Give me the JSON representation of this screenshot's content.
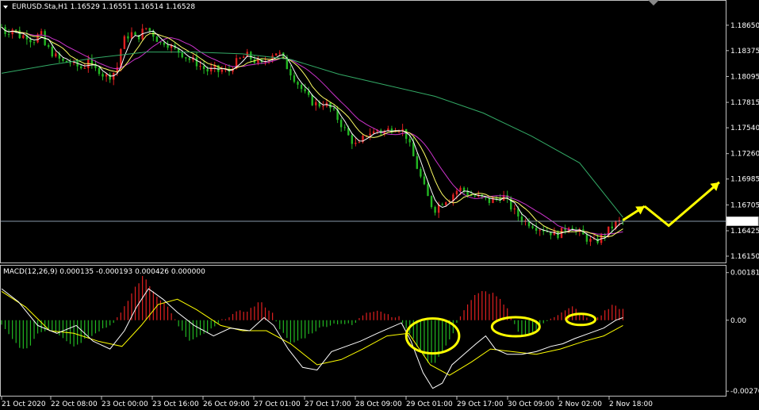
{
  "header": {
    "symbol_line": "EURUSD.Sta,H1  1.16529 1.16551 1.16514 1.16528",
    "macd_line": "MACD(12,26,9) 0.000135 -0.000193 0.000426 0.000000"
  },
  "colors": {
    "background": "#000000",
    "bull": "#e02020",
    "bear": "#22b822",
    "ma_fast": "#ffffff",
    "ma_mid": "#ffff66",
    "ma_slow": "#cc33cc",
    "ma_long": "#33aa66",
    "macd_line": "#ffffff",
    "signal_line": "#ffff00",
    "annotation": "#ffff00",
    "bid_line": "#8899aa",
    "frame": "#c0c0c0"
  },
  "chart_data": [
    {
      "type": "candlestick",
      "panel": "price",
      "title": "EURUSD.Sta,H1",
      "ohlc_last": {
        "open": 1.16529,
        "high": 1.16551,
        "low": 1.16514,
        "close": 1.16528
      },
      "y_ticks": [
        "1.18650",
        "1.18375",
        "1.18095",
        "1.17815",
        "1.17540",
        "1.17260",
        "1.16985",
        "1.16705",
        "1.16425",
        "1.16150"
      ],
      "y_tick_values": [
        1.1865,
        1.18375,
        1.18095,
        1.17815,
        1.1754,
        1.1726,
        1.16985,
        1.16705,
        1.16425,
        1.1615
      ],
      "ylim": [
        1.1609,
        1.1882
      ],
      "current_price_label": "1.16528",
      "current_price": 1.16528,
      "x_ticks": [
        "21 Oct 2020",
        "22 Oct 08:00",
        "23 Oct 00:00",
        "23 Oct 16:00",
        "26 Oct 09:00",
        "27 Oct 01:00",
        "27 Oct 17:00",
        "28 Oct 09:00",
        "29 Oct 01:00",
        "29 Oct 17:00",
        "30 Oct 09:00",
        "2 Nov 02:00",
        "2 Nov 18:00"
      ],
      "close_path": [
        [
          0,
          1.1863
        ],
        [
          4,
          1.1856
        ],
        [
          8,
          1.1862
        ],
        [
          12,
          1.1858
        ],
        [
          16,
          1.1852
        ],
        [
          20,
          1.1855
        ],
        [
          24,
          1.185
        ],
        [
          28,
          1.1849
        ],
        [
          32,
          1.1858
        ],
        [
          36,
          1.1843
        ],
        [
          40,
          1.1838
        ],
        [
          44,
          1.1832
        ],
        [
          48,
          1.1828
        ],
        [
          52,
          1.1824
        ],
        [
          56,
          1.1826
        ],
        [
          60,
          1.1822
        ],
        [
          64,
          1.182
        ],
        [
          68,
          1.1818
        ],
        [
          72,
          1.183
        ],
        [
          76,
          1.1815
        ],
        [
          80,
          1.1818
        ],
        [
          84,
          1.1812
        ],
        [
          88,
          1.1809
        ],
        [
          92,
          1.1812
        ],
        [
          96,
          1.182
        ],
        [
          100,
          1.1846
        ],
        [
          104,
          1.1853
        ],
        [
          108,
          1.1856
        ],
        [
          112,
          1.185
        ],
        [
          116,
          1.1857
        ],
        [
          120,
          1.1862
        ],
        [
          124,
          1.1858
        ],
        [
          128,
          1.1852
        ],
        [
          132,
          1.1845
        ],
        [
          136,
          1.1848
        ],
        [
          140,
          1.1842
        ],
        [
          144,
          1.1838
        ],
        [
          148,
          1.1836
        ],
        [
          152,
          1.1832
        ],
        [
          156,
          1.1828
        ],
        [
          160,
          1.1826
        ],
        [
          164,
          1.1822
        ],
        [
          168,
          1.1818
        ],
        [
          172,
          1.1815
        ],
        [
          176,
          1.1818
        ],
        [
          180,
          1.1815
        ],
        [
          184,
          1.1817
        ],
        [
          188,
          1.1813
        ],
        [
          192,
          1.1822
        ],
        [
          196,
          1.1826
        ],
        [
          200,
          1.183
        ],
        [
          204,
          1.1832
        ],
        [
          208,
          1.1828
        ],
        [
          212,
          1.1825
        ],
        [
          216,
          1.1822
        ],
        [
          220,
          1.1828
        ],
        [
          224,
          1.1834
        ],
        [
          228,
          1.1836
        ],
        [
          232,
          1.1832
        ],
        [
          236,
          1.1822
        ],
        [
          240,
          1.1814
        ],
        [
          244,
          1.1806
        ],
        [
          248,
          1.1798
        ],
        [
          252,
          1.179
        ],
        [
          256,
          1.1784
        ],
        [
          260,
          1.178
        ],
        [
          264,
          1.1779
        ],
        [
          268,
          1.1781
        ],
        [
          272,
          1.1776
        ],
        [
          276,
          1.177
        ],
        [
          280,
          1.1762
        ],
        [
          284,
          1.1754
        ],
        [
          288,
          1.1745
        ],
        [
          292,
          1.1738
        ],
        [
          296,
          1.1733
        ],
        [
          300,
          1.1742
        ],
        [
          304,
          1.175
        ],
        [
          308,
          1.1748
        ],
        [
          312,
          1.1752
        ],
        [
          316,
          1.1749
        ],
        [
          320,
          1.1751
        ],
        [
          324,
          1.1754
        ],
        [
          328,
          1.1755
        ],
        [
          332,
          1.1753
        ],
        [
          336,
          1.1745
        ],
        [
          340,
          1.173
        ],
        [
          344,
          1.1715
        ],
        [
          348,
          1.17
        ],
        [
          352,
          1.1685
        ],
        [
          356,
          1.1672
        ],
        [
          360,
          1.1666
        ],
        [
          364,
          1.1672
        ],
        [
          368,
          1.1676
        ],
        [
          372,
          1.1678
        ],
        [
          376,
          1.1684
        ],
        [
          380,
          1.1688
        ],
        [
          384,
          1.1686
        ],
        [
          388,
          1.1682
        ],
        [
          392,
          1.168
        ],
        [
          396,
          1.1679
        ],
        [
          400,
          1.1677
        ],
        [
          404,
          1.1674
        ],
        [
          408,
          1.1676
        ],
        [
          412,
          1.1678
        ],
        [
          416,
          1.1681
        ],
        [
          420,
          1.1674
        ],
        [
          424,
          1.1666
        ],
        [
          428,
          1.166
        ],
        [
          432,
          1.1655
        ],
        [
          436,
          1.1652
        ],
        [
          440,
          1.165
        ],
        [
          444,
          1.1647
        ],
        [
          448,
          1.1645
        ],
        [
          452,
          1.1643
        ],
        [
          456,
          1.1641
        ],
        [
          460,
          1.1638
        ],
        [
          464,
          1.164
        ],
        [
          468,
          1.1645
        ],
        [
          472,
          1.165
        ],
        [
          476,
          1.1642
        ],
        [
          480,
          1.164
        ],
        [
          484,
          1.1636
        ],
        [
          488,
          1.1632
        ],
        [
          492,
          1.163
        ],
        [
          496,
          1.1633
        ],
        [
          500,
          1.1638
        ],
        [
          504,
          1.1643
        ],
        [
          508,
          1.1648
        ],
        [
          512,
          1.1652
        ],
        [
          516,
          1.1653
        ]
      ],
      "ma_long_path": [
        [
          0,
          1.1813
        ],
        [
          40,
          1.1822
        ],
        [
          80,
          1.183
        ],
        [
          120,
          1.1836
        ],
        [
          160,
          1.1836
        ],
        [
          200,
          1.1834
        ],
        [
          240,
          1.1828
        ],
        [
          280,
          1.1812
        ],
        [
          320,
          1.18
        ],
        [
          360,
          1.1788
        ],
        [
          400,
          1.177
        ],
        [
          440,
          1.1745
        ],
        [
          480,
          1.1716
        ],
        [
          516,
          1.1657
        ]
      ],
      "annotation_arrow_prices": [
        1.1654,
        1.1669,
        1.1648,
        1.1695
      ],
      "annotation_arrow_steps": [
        516,
        534,
        554,
        596
      ]
    },
    {
      "type": "bar",
      "panel": "macd",
      "title": "MACD(12,26,9)",
      "values_last": {
        "macd": 0.000135,
        "signal": -0.000193,
        "histogram": 0.000426,
        "extra": 0.0
      },
      "y_ticks": [
        "0.001816",
        "0.00",
        "-0.002706"
      ],
      "y_tick_values": [
        0.001816,
        0.0,
        -0.002706
      ],
      "ylim": [
        -0.00285,
        0.00205
      ],
      "hist_profile": [
        [
          0,
          -0.0002
        ],
        [
          10,
          -0.0008
        ],
        [
          20,
          -0.0012
        ],
        [
          30,
          -0.0005
        ],
        [
          40,
          -0.0003
        ],
        [
          50,
          -0.0006
        ],
        [
          60,
          -0.001
        ],
        [
          70,
          -0.0007
        ],
        [
          80,
          -0.0004
        ],
        [
          90,
          -0.0002
        ],
        [
          100,
          0.0003
        ],
        [
          110,
          0.0012
        ],
        [
          118,
          0.0017
        ],
        [
          126,
          0.0011
        ],
        [
          134,
          0.0007
        ],
        [
          140,
          0.0004
        ],
        [
          146,
          -0.0002
        ],
        [
          156,
          -0.0008
        ],
        [
          166,
          -0.0006
        ],
        [
          176,
          -0.0003
        ],
        [
          186,
          0.0001
        ],
        [
          196,
          0.0003
        ],
        [
          206,
          0.0004
        ],
        [
          214,
          0.0007
        ],
        [
          220,
          0.0005
        ],
        [
          226,
          0.0002
        ],
        [
          232,
          -0.0004
        ],
        [
          240,
          -0.0009
        ],
        [
          250,
          -0.0007
        ],
        [
          260,
          -0.0004
        ],
        [
          270,
          -0.0002
        ],
        [
          280,
          -0.0001
        ],
        [
          292,
          -0.0002
        ],
        [
          302,
          0.0003
        ],
        [
          312,
          0.0004
        ],
        [
          322,
          0.0002
        ],
        [
          330,
          0.0001
        ],
        [
          336,
          -0.0003
        ],
        [
          344,
          -0.0009
        ],
        [
          352,
          -0.0015
        ],
        [
          358,
          -0.0017
        ],
        [
          366,
          -0.0012
        ],
        [
          374,
          -0.0006
        ],
        [
          382,
          0.0003
        ],
        [
          392,
          0.0009
        ],
        [
          400,
          0.0011
        ],
        [
          410,
          0.001
        ],
        [
          420,
          0.0004
        ],
        [
          426,
          -0.0002
        ],
        [
          432,
          -0.0006
        ],
        [
          440,
          -0.0005
        ],
        [
          448,
          -0.0002
        ],
        [
          456,
          0.0001
        ],
        [
          466,
          0.0003
        ],
        [
          474,
          0.0005
        ],
        [
          484,
          0.0002
        ],
        [
          490,
          -0.0001
        ],
        [
          500,
          0.0003
        ],
        [
          508,
          0.0006
        ],
        [
          516,
          0.0004
        ]
      ],
      "macd_path": [
        [
          0,
          0.0012
        ],
        [
          14,
          0.0007
        ],
        [
          30,
          -0.0002
        ],
        [
          46,
          -0.0005
        ],
        [
          62,
          -0.0002
        ],
        [
          76,
          -0.0008
        ],
        [
          90,
          -0.0011
        ],
        [
          102,
          -0.0004
        ],
        [
          112,
          0.0005
        ],
        [
          122,
          0.0012
        ],
        [
          134,
          0.0008
        ],
        [
          146,
          0.0003
        ],
        [
          160,
          -0.0002
        ],
        [
          176,
          -0.0006
        ],
        [
          190,
          -0.0003
        ],
        [
          206,
          -0.0004
        ],
        [
          218,
          0.0001
        ],
        [
          226,
          -0.0002
        ],
        [
          238,
          -0.0011
        ],
        [
          250,
          -0.0018
        ],
        [
          262,
          -0.0019
        ],
        [
          274,
          -0.0012
        ],
        [
          286,
          -0.001
        ],
        [
          298,
          -0.0008
        ],
        [
          312,
          -0.0005
        ],
        [
          322,
          -0.0003
        ],
        [
          332,
          -0.0001
        ],
        [
          340,
          -0.0008
        ],
        [
          350,
          -0.002
        ],
        [
          358,
          -0.0026
        ],
        [
          366,
          -0.0024
        ],
        [
          374,
          -0.0017
        ],
        [
          384,
          -0.0013
        ],
        [
          394,
          -0.0009
        ],
        [
          402,
          -0.0006
        ],
        [
          410,
          -0.0011
        ],
        [
          420,
          -0.0013
        ],
        [
          432,
          -0.0013
        ],
        [
          444,
          -0.0012
        ],
        [
          456,
          -0.001
        ],
        [
          466,
          -0.0009
        ],
        [
          476,
          -0.0007
        ],
        [
          488,
          -0.0005
        ],
        [
          500,
          -0.0003
        ],
        [
          510,
          0.0
        ],
        [
          516,
          0.0001
        ]
      ],
      "signal_path": [
        [
          0,
          0.0011
        ],
        [
          20,
          0.0005
        ],
        [
          40,
          -0.0004
        ],
        [
          60,
          -0.0005
        ],
        [
          80,
          -0.0008
        ],
        [
          100,
          -0.001
        ],
        [
          116,
          -0.0002
        ],
        [
          130,
          0.0006
        ],
        [
          146,
          0.0008
        ],
        [
          162,
          0.0004
        ],
        [
          182,
          -0.0002
        ],
        [
          200,
          -0.0004
        ],
        [
          220,
          -0.0004
        ],
        [
          240,
          -0.0009
        ],
        [
          262,
          -0.0017
        ],
        [
          282,
          -0.0015
        ],
        [
          300,
          -0.0011
        ],
        [
          320,
          -0.0006
        ],
        [
          338,
          -0.0005
        ],
        [
          356,
          -0.0017
        ],
        [
          372,
          -0.0021
        ],
        [
          390,
          -0.0016
        ],
        [
          406,
          -0.0011
        ],
        [
          424,
          -0.0012
        ],
        [
          444,
          -0.0013
        ],
        [
          464,
          -0.0011
        ],
        [
          484,
          -0.0008
        ],
        [
          500,
          -0.0006
        ],
        [
          516,
          -0.0002
        ]
      ],
      "highlight_circles": [
        {
          "step": 358,
          "value": -0.0006,
          "w": 40,
          "h": 22
        },
        {
          "step": 427,
          "value": -0.00025,
          "w": 36,
          "h": 12
        },
        {
          "step": 481,
          "value": 3e-05,
          "w": 22,
          "h": 7
        }
      ]
    }
  ]
}
